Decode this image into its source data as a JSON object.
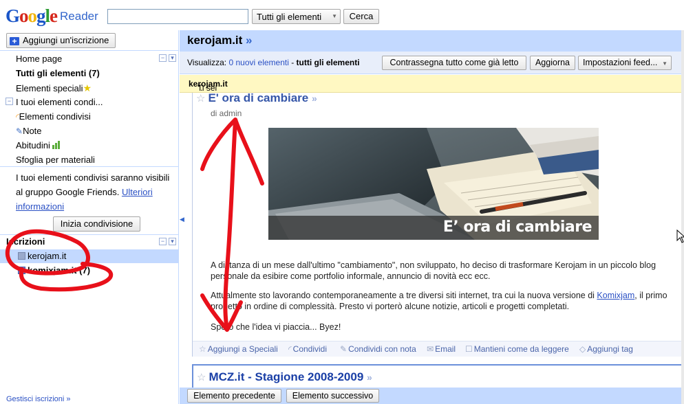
{
  "logo": {
    "brand": "Google",
    "product": "Reader"
  },
  "search": {
    "placeholder": "",
    "scope": "Tutti gli elementi",
    "button": "Cerca"
  },
  "sidebar": {
    "add_subscription": "Aggiungi un'iscrizione",
    "items": [
      {
        "label": "Home page"
      },
      {
        "label": "Tutti gli elementi (7)"
      },
      {
        "label": "Elementi speciali"
      },
      {
        "label": "I tuoi elementi condi..."
      },
      {
        "label": "Elementi condivisi"
      },
      {
        "label": "Note"
      },
      {
        "label": "Abitudini"
      },
      {
        "label": "Sfoglia per materiali"
      }
    ],
    "share_text_1": "I tuoi elementi condivisi saranno visibili al gruppo Google Friends.",
    "share_link": "Ulteriori informazioni",
    "start_share": "Inizia condivisione",
    "subs_header": "Iscrizioni",
    "subscriptions": [
      {
        "label": "kerojam.it"
      },
      {
        "label": "komixjam.it (7)"
      }
    ],
    "manage": "Gestisci iscrizioni »"
  },
  "main": {
    "feed_title": "kerojam.it",
    "feed_title_arrow": "»",
    "view_label": "Visualizza:",
    "view_new": "0 nuovi elementi",
    "view_sep": " - ",
    "view_all": "tutti gli elementi",
    "mark_all": "Contrassegna tutto come già letto",
    "refresh": "Aggiorna",
    "feed_settings": "Impostazioni feed...",
    "notice_prefix": "Ti sei iscritto a \"",
    "notice_feed": "kerojam.it",
    "notice_suffix": "\"."
  },
  "entry": {
    "title": "E' ora di cambiare",
    "author": "di admin",
    "image_caption": "E’ ora di cambiare",
    "p1": "A distanza di un mese dall'ultimo \"cambiamento\", non sviluppato, ho deciso di trasformare Kerojam in un piccolo blog personale da esibire come portfolio informale, annuncio di novità ecc ecc.",
    "p2a": "Attualmente sto lavorando contemporaneamente a tre diversi siti internet, tra cui la nuova versione di ",
    "p2link": "Komixjam",
    "p2b": ", il primo progetto in ordine di complessità. Presto vi porterò alcune notizie, articoli e progetti completati.",
    "p3": "Spero che l'idea vi piaccia... Byez!",
    "actions": {
      "star": "Aggiungi a Speciali",
      "share": "Condividi",
      "share_note": "Condividi con nota",
      "email": "Email",
      "keep_unread": "Mantieni come da leggere",
      "tag": "Aggiungi tag"
    }
  },
  "entry2": {
    "title": "MCZ.it - Stagione 2008-2009"
  },
  "bottom": {
    "prev": "Elemento precedente",
    "next": "Elemento successivo"
  },
  "colors": {
    "accent": "#c3d9ff",
    "link": "#2a50c4",
    "notice": "#fff8c2",
    "annotation": "#e8101a"
  }
}
